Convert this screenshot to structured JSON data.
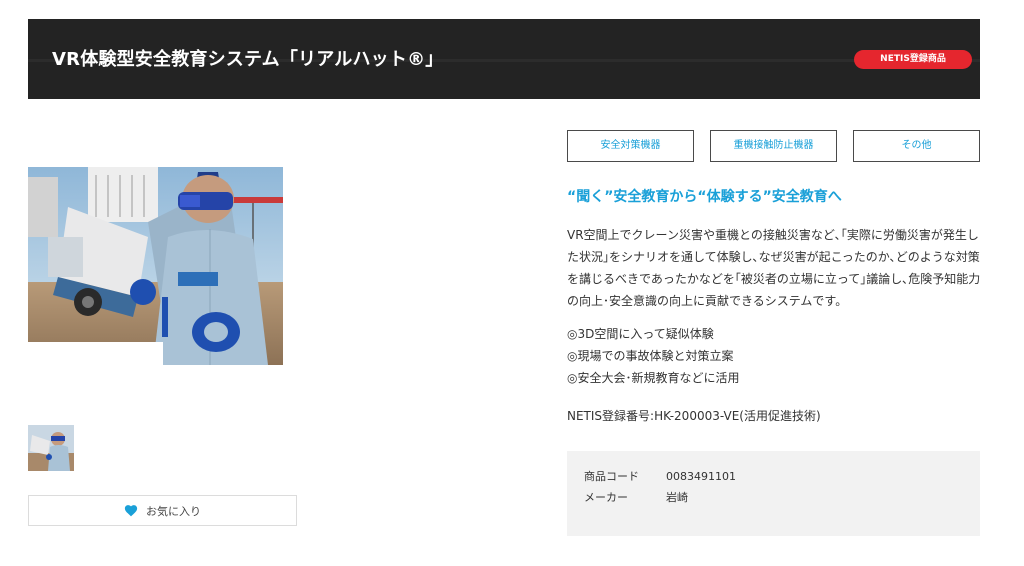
{
  "header": {
    "title": "VR体験型安全教育システム「リアルハット®」",
    "badge": "NETIS登録商品"
  },
  "gallery": {
    "favorite_label": "お気に入り"
  },
  "tags": [
    {
      "label": "安全対策機器"
    },
    {
      "label": "重機接触防止機器"
    },
    {
      "label": "その他"
    }
  ],
  "product": {
    "headline": "“聞く”安全教育から“体験する”安全教育へ",
    "description": "VR空間上でクレーン災害や重機との接触災害など､｢実際に労働災害が発生した状況｣をシナリオを通して体験し､なぜ災害が起こったのか､どのような対策を講じるべきであったかなどを｢被災者の立場に立って｣議論し､危険予知能力の向上･安全意識の向上に貢献できるシステムです。",
    "features": [
      "◎3D空間に入って疑似体験",
      "◎現場での事故体験と対策立案",
      "◎安全大会･新規教育などに活用"
    ],
    "netis_number": "NETIS登録番号:HK-200003-VE(活用促進技術)"
  },
  "spec": {
    "code_label": "商品コード",
    "code_value": "0083491101",
    "maker_label": "メーカー",
    "maker_value": "岩崎"
  },
  "colors": {
    "accent": "#1aa0d8",
    "badge": "#e5262e",
    "header_bg": "#232323",
    "heart": "#1aa0d8"
  }
}
